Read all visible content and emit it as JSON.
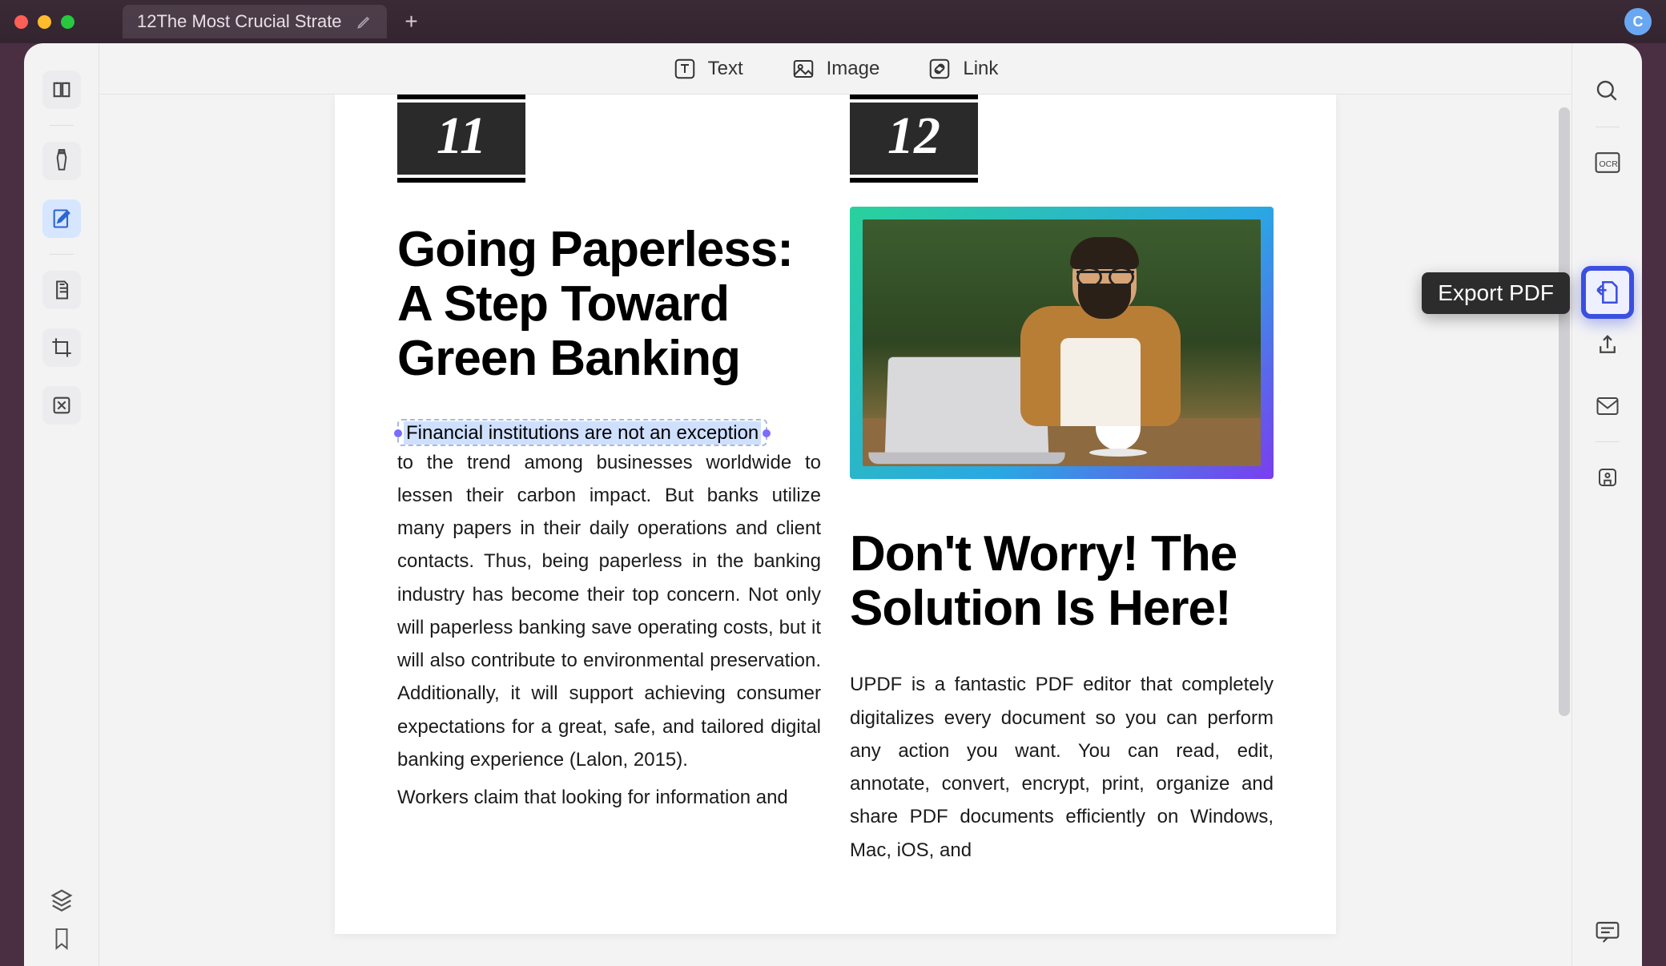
{
  "titlebar": {
    "tab_title": "12The Most Crucial Strate",
    "avatar_initial": "C"
  },
  "toolbar": {
    "text_label": "Text",
    "image_label": "Image",
    "link_label": "Link"
  },
  "tooltip": {
    "export_pdf": "Export PDF"
  },
  "left_rail_icons": [
    "reader-icon",
    "highlighter-icon",
    "edit-icon",
    "page-icon",
    "crop-icon",
    "stamp-icon"
  ],
  "right_rail_icons": [
    "search-icon",
    "ocr-icon",
    "export-pdf-icon",
    "protect-icon",
    "share-icon",
    "email-icon",
    "save-icon"
  ],
  "doc": {
    "left": {
      "number": "11",
      "heading": "Going Paperless: A Step Toward Green Banking",
      "selected_text": "Financial institutions are not an exception",
      "para_rest": " to the trend among businesses worldwide to lessen their carbon impact. But banks utilize many papers in their daily operations and client contacts. Thus, being paperless in the banking industry has become their top concern. Not only will paperless banking save operating costs, but it will also contribute to environmental preservation. Additionally, it will support achieving consumer expectations for a great, safe, and tailored digital banking experience (Lalon, 2015).",
      "para2": "Workers claim that looking for information and"
    },
    "right": {
      "number": "12",
      "heading": "Don't Worry! The Solution Is Here!",
      "para": "UPDF is a fantastic PDF editor that completely digitalizes every document so you can perform any action you want. You can read, edit, annotate, convert, encrypt, print, organize and share PDF documents efficiently on Windows, Mac, iOS, and"
    }
  }
}
